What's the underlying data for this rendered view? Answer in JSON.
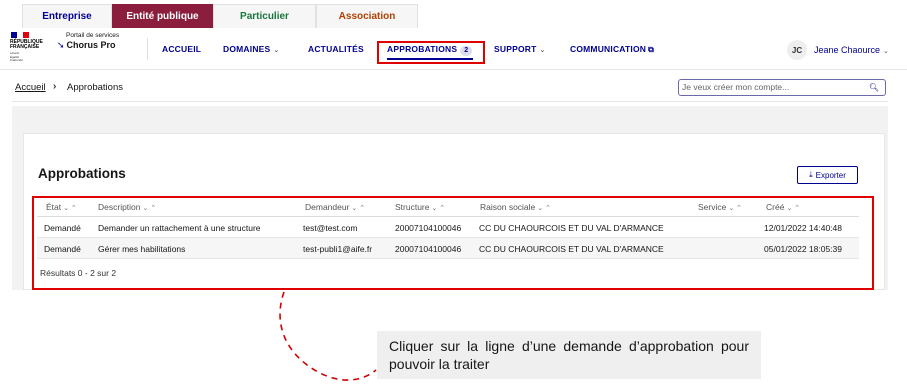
{
  "audience_tabs": [
    "Entreprise",
    "Entité publique",
    "Particulier",
    "Association"
  ],
  "header": {
    "logo_lines": [
      "RÉPUBLIQUE",
      "FRANÇAISE"
    ],
    "logo_motto": [
      "Liberté",
      "Égalité",
      "Fraternité"
    ],
    "portal_small": "Portail de services",
    "portal_name": "Chorus Pro"
  },
  "nav": {
    "accueil": "ACCUEIL",
    "domaines": "DOMAINES",
    "actualites": "ACTUALITÉS",
    "approbations": "APPROBATIONS",
    "approbations_badge": "2",
    "support": "SUPPORT",
    "communication": "COMMUNICATION"
  },
  "user": {
    "initials": "JC",
    "name": "Jeane Chaource"
  },
  "breadcrumb": {
    "home": "Accueil",
    "separator": "›",
    "current": "Approbations"
  },
  "search": {
    "placeholder": "Je veux créer mon compte..."
  },
  "page": {
    "title": "Approbations",
    "export_label": "Exporter"
  },
  "table": {
    "columns": [
      "État",
      "Description",
      "Demandeur",
      "Structure",
      "Raison sociale",
      "Service",
      "Créé"
    ],
    "rows": [
      [
        "Demandé",
        "Demander un rattachement à une structure",
        "test@test.com",
        "20007104100046",
        "CC DU CHAOURCOIS ET DU VAL D'ARMANCE",
        "",
        "12/01/2022 14:40:48"
      ],
      [
        "Demandé",
        "Gérer mes habilitations",
        "test-publi1@aife.fr",
        "20007104100046",
        "CC DU CHAOURCOIS ET DU VAL D'ARMANCE",
        "",
        "05/01/2022 18:05:39"
      ]
    ],
    "results": "Résultats 0 - 2 sur 2"
  },
  "callout": {
    "text": "Cliquer sur la ligne d’une demande d’approbation pour pouvoir la traiter"
  },
  "colors": {
    "primary": "#000091",
    "public_tab": "#8a1e3c",
    "highlight": "#e00000"
  }
}
